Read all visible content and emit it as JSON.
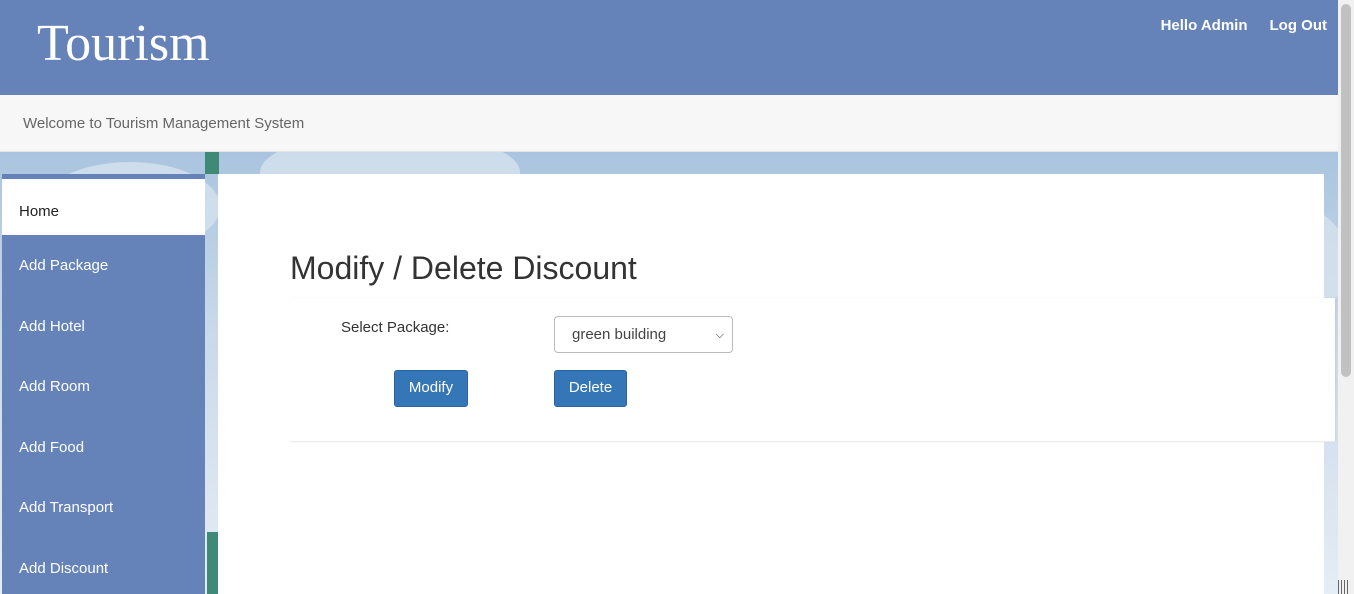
{
  "header": {
    "brand": "Tourism",
    "greeting": "Hello Admin",
    "logout": "Log Out"
  },
  "welcome": "Welcome to Tourism Management System",
  "sidebar": {
    "items": [
      {
        "label": "Home",
        "active": true
      },
      {
        "label": "Add Package"
      },
      {
        "label": "Add Hotel"
      },
      {
        "label": "Add Room"
      },
      {
        "label": "Add Food"
      },
      {
        "label": "Add Transport"
      },
      {
        "label": "Add Discount"
      }
    ]
  },
  "main": {
    "title": "Modify / Delete Discount",
    "select_label": "Select Package:",
    "select_value": "green building",
    "modify_label": "Modify",
    "delete_label": "Delete"
  },
  "colors": {
    "header_bg": "#6583b9",
    "button_bg": "#3476b6"
  }
}
